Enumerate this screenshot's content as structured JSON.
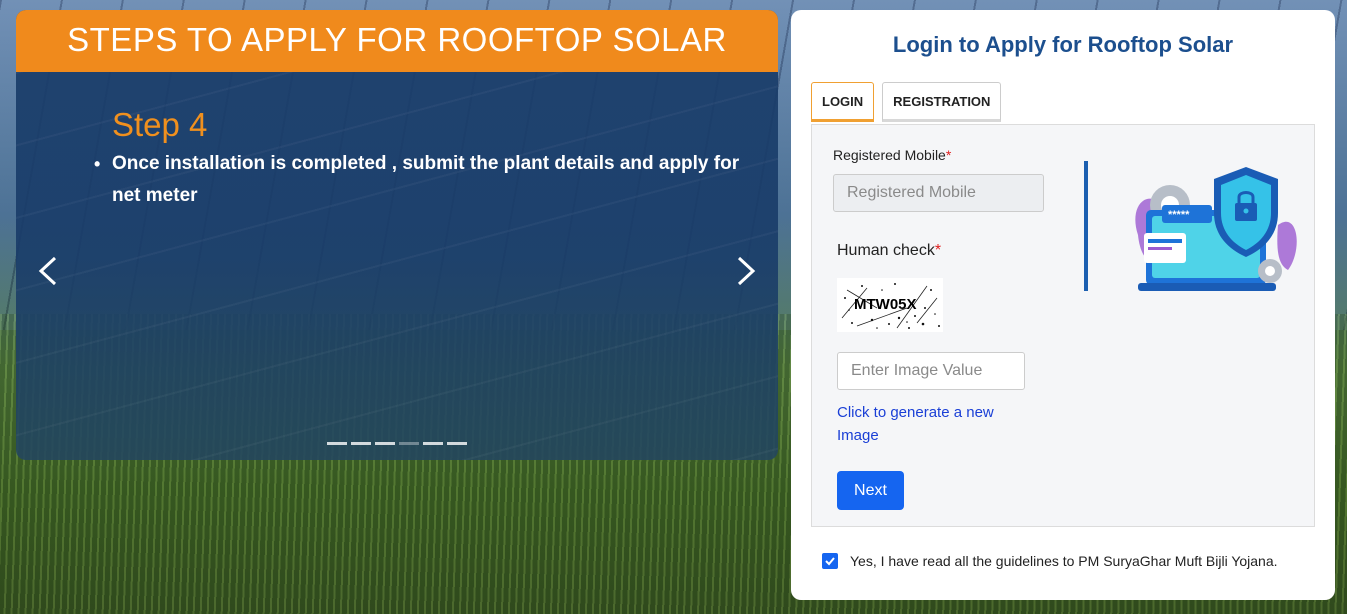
{
  "carousel": {
    "header": "STEPS TO APPLY FOR ROOFTOP SOLAR",
    "step_title": "Step 4",
    "step_items": [
      "Once installation is completed , submit the plant details and apply for net meter"
    ],
    "prev_icon": "chevron-left-icon",
    "next_icon": "chevron-right-icon",
    "slide_count": 6,
    "active_slide": 4
  },
  "login_card": {
    "title": "Login to Apply for Rooftop Solar",
    "tabs": [
      {
        "label": "LOGIN",
        "active": true
      },
      {
        "label": "REGISTRATION",
        "active": false
      }
    ],
    "mobile_label": "Registered Mobile",
    "mobile_required_mark": "*",
    "mobile_placeholder": "Registered Mobile",
    "mobile_value": "",
    "human_check_label": "Human check",
    "human_check_required_mark": "*",
    "captcha_text": "MTW05X",
    "image_value_placeholder": "Enter Image Value",
    "image_value": "",
    "regenerate_link": "Click to generate a new Image",
    "next_button": "Next",
    "agree_text": "Yes, I have read all the guidelines to PM SuryaGhar Muft Bijli Yojana.",
    "agree_checked": true
  },
  "colors": {
    "header_orange": "#f08a1c",
    "title_blue": "#1c4f8e",
    "primary_button": "#1565f0",
    "tab_active_border": "#f0a032"
  }
}
